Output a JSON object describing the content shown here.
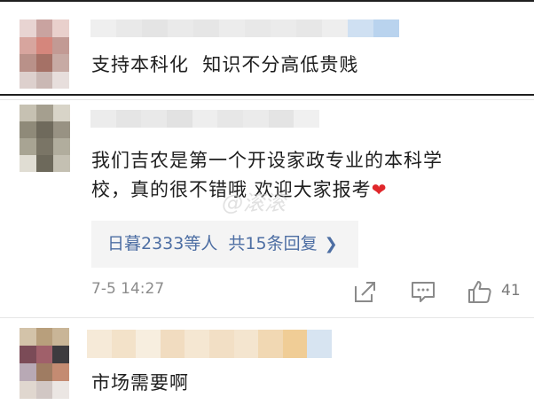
{
  "comments": [
    {
      "text": "支持本科化  知识不分高低贵贱",
      "avatar": "pixelated-avatar",
      "username": "blurred-username"
    },
    {
      "text_line1": "我们吉农是第一个开设家政专业的本科学",
      "text_line2": "校，真的很不错哦 欢迎大家报考",
      "avatar": "pixelated-avatar",
      "username": "blurred-username",
      "reply_summary": "日暮2333等人  共15条回复",
      "time": "7-5 14:27",
      "like_count": "41",
      "watermark": "@滚滚"
    },
    {
      "text": "市场需要啊",
      "avatar": "pixelated-avatar",
      "username": "blurred-username"
    }
  ],
  "icons": {
    "chevron": "chevron-right-icon",
    "share": "share-icon",
    "comment": "comment-icon",
    "like": "thumbs-up-icon",
    "heart": "heart-icon"
  },
  "colors": {
    "link_blue": "#4d6ea3",
    "meta_gray": "#8c8c8c",
    "reply_bg": "#f4f4f4",
    "heart_red": "#e0272b"
  }
}
